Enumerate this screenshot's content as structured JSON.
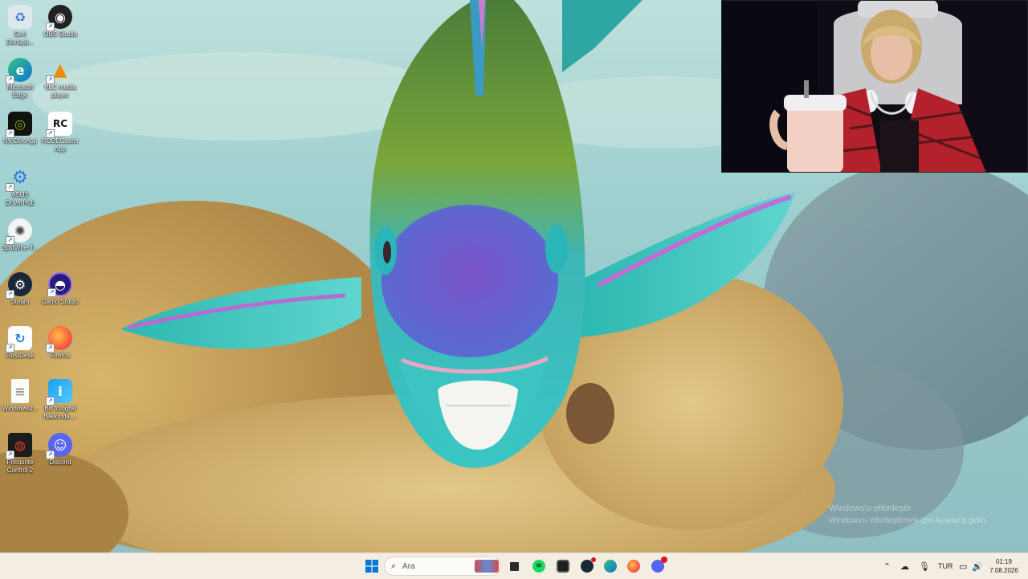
{
  "desktop": {
    "icons": [
      {
        "label": "Geri Dönüşü...",
        "icon": "recycle-bin-icon"
      },
      {
        "label": "OBS Studio",
        "icon": "obs-icon"
      },
      {
        "label": "Microsoft Edge",
        "icon": "edge-icon"
      },
      {
        "label": "VLC media player",
        "icon": "vlc-icon"
      },
      {
        "label": "NVIDIA App",
        "icon": "nvidia-icon"
      },
      {
        "label": "RODECaster App",
        "icon": "rodecaster-icon"
      },
      {
        "label": "ASUS DriverHub",
        "icon": "asus-driverhub-icon"
      },
      {
        "label": "SplitWire-T...",
        "icon": "splitwire-icon"
      },
      {
        "label": "Steam",
        "icon": "steam-icon"
      },
      {
        "label": "Camo Studio",
        "icon": "camo-icon"
      },
      {
        "label": "RustDesk",
        "icon": "rustdesk-icon"
      },
      {
        "label": "Firefox",
        "icon": "firefox-icon"
      },
      {
        "label": "WindowsU...",
        "icon": "document-icon"
      },
      {
        "label": "Bu fotoğraf hakkında ...",
        "icon": "photo-info-icon"
      },
      {
        "label": "Focusrite Control 2",
        "icon": "focusrite-icon"
      },
      {
        "label": "Discord",
        "icon": "discord-icon"
      }
    ]
  },
  "watermark": {
    "title": "Windows'u etkinleştir",
    "subtitle": "Windows'u etkinleştirmek için Ayarlar'a gidin."
  },
  "taskbar": {
    "search_placeholder": "Ara",
    "pinned": [
      "start-icon",
      "search-icon",
      "task-view-icon",
      "spotify-icon",
      "obs-icon",
      "steam-icon",
      "edge-icon",
      "firefox-icon",
      "discord-icon"
    ],
    "discord_badge": "",
    "tray": {
      "language": "TUR",
      "time": "01:19",
      "date": "7.08.2026"
    }
  },
  "colors": {
    "taskbar_bg": "#f3ede2",
    "accent": "#0067c0"
  }
}
